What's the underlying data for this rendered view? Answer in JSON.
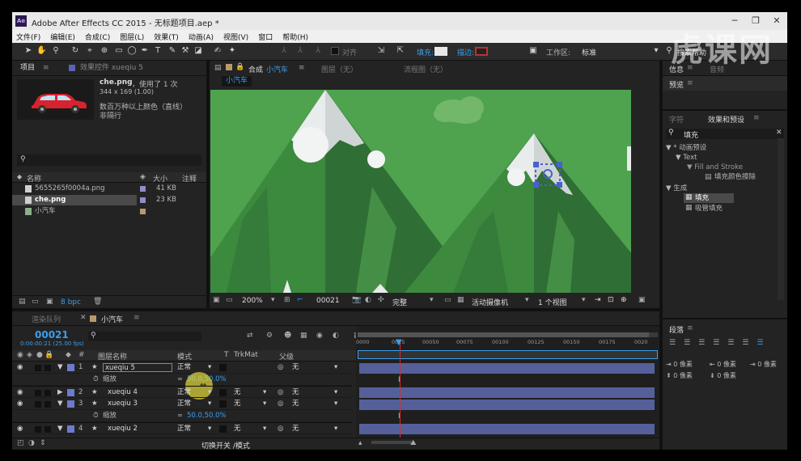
{
  "title_bar": {
    "logo": "Ae",
    "title": "Adobe After Effects CC 2015 - 无标题项目.aep *",
    "min": "─",
    "max": "❐",
    "close": "✕"
  },
  "menu": [
    "文件(F)",
    "编辑(E)",
    "合成(C)",
    "图层(L)",
    "效果(T)",
    "动画(A)",
    "视图(V)",
    "窗口",
    "帮助(H)"
  ],
  "toolbar": {
    "align_label": "对齐",
    "fill_label": "填充:",
    "stroke_label": "描边:",
    "workspace_label": "工作区:",
    "workspace_value": "标准",
    "search_help": "搜索帮助"
  },
  "project_panel": {
    "tab_project": "项目",
    "tab_effects_controls": "效果控件 xueqiu 5",
    "selected_name": "che.png",
    "used_info": "，使用了 1 次",
    "dimensions": "344 x 169 (1.00)",
    "color_info": "数百万种以上颜色（直线）",
    "interlace": "非隔行",
    "col_name": "名称",
    "col_size": "大小",
    "col_comment": "注释",
    "items": [
      {
        "name": "5655265f0004a.png",
        "size": "41 KB",
        "color": "#8e8ec8"
      },
      {
        "name": "che.png",
        "size": "23 KB",
        "color": "#8e8ec8"
      },
      {
        "name": "小汽车",
        "size": "",
        "color": "#b89a6a"
      }
    ],
    "bpc": "8 bpc"
  },
  "composition_panel": {
    "tab_comp": "合成",
    "comp_name": "小汽车",
    "tab_layer": "图层（无）",
    "tab_flowchart": "流程图（无）",
    "comp_tab": "小汽车",
    "zoom": "200%",
    "timecode": "00021",
    "quality": "完整",
    "camera": "活动摄像机",
    "views": "1 个视图"
  },
  "right_panels": {
    "info": "信息",
    "audio": "音频",
    "preview": "预览",
    "characters": "字符",
    "effects_presets": "效果和预设",
    "search_value": "填充",
    "tree": [
      {
        "label": "▼ * 动画预设",
        "indent": 0
      },
      {
        "label": "▼ Text",
        "indent": 1
      },
      {
        "label": "▼ Fill and Stroke",
        "indent": 2
      },
      {
        "label": "填充颜色擦除",
        "indent": 3
      },
      {
        "label": "▼ 生成",
        "indent": 0
      },
      {
        "label": "填充",
        "indent": 1
      },
      {
        "label": "吸管填充",
        "indent": 1
      }
    ],
    "paragraph": "段落",
    "para_values": [
      "0 像素",
      "0 像素",
      "0 像素",
      "0 像素",
      "0 像素"
    ]
  },
  "timeline": {
    "tab_render_queue": "渲染队列",
    "tab_comp": "小汽车",
    "timecode": "00021",
    "timecode_sub": "0:00:00:21 (25.00 fps)",
    "col_layer_name": "图层名称",
    "col_mode": "模式",
    "col_t": "T",
    "col_trkmat": "TrkMat",
    "col_parent": "父级",
    "layers": [
      {
        "num": "1",
        "name": "xueqiu 5",
        "mode": "正常",
        "trkmat": "",
        "parent": "无",
        "color": "#6d7bcc",
        "expanded": true,
        "prop": "缩放",
        "prop_value": "50.0,50.0%"
      },
      {
        "num": "2",
        "name": "xueqiu 4",
        "mode": "正常",
        "trkmat": "无",
        "parent": "无",
        "color": "#6d7bcc",
        "expanded": false
      },
      {
        "num": "3",
        "name": "xueqiu 3",
        "mode": "正常",
        "trkmat": "无",
        "parent": "无",
        "color": "#6d7bcc",
        "expanded": true,
        "prop": "缩放",
        "prop_value": "50.0,50.0%"
      },
      {
        "num": "4",
        "name": "xueqiu 2",
        "mode": "正常",
        "trkmat": "无",
        "parent": "无",
        "color": "#6d7bcc",
        "expanded": false
      }
    ],
    "ruler": [
      "0000",
      "0025",
      "00050",
      "00075",
      "00100",
      "00125",
      "00150",
      "00175",
      "0020"
    ],
    "switch_mode": "切换开关 /模式"
  },
  "watermark": "虎课网",
  "colors": {
    "sky": "#4fa24e",
    "mountain_dark": "#2f6e34",
    "mountain_mid": "#3d8a3f",
    "snow": "#e8ecec",
    "accent_blue": "#2d8ceb",
    "playhead": "#d03030"
  }
}
